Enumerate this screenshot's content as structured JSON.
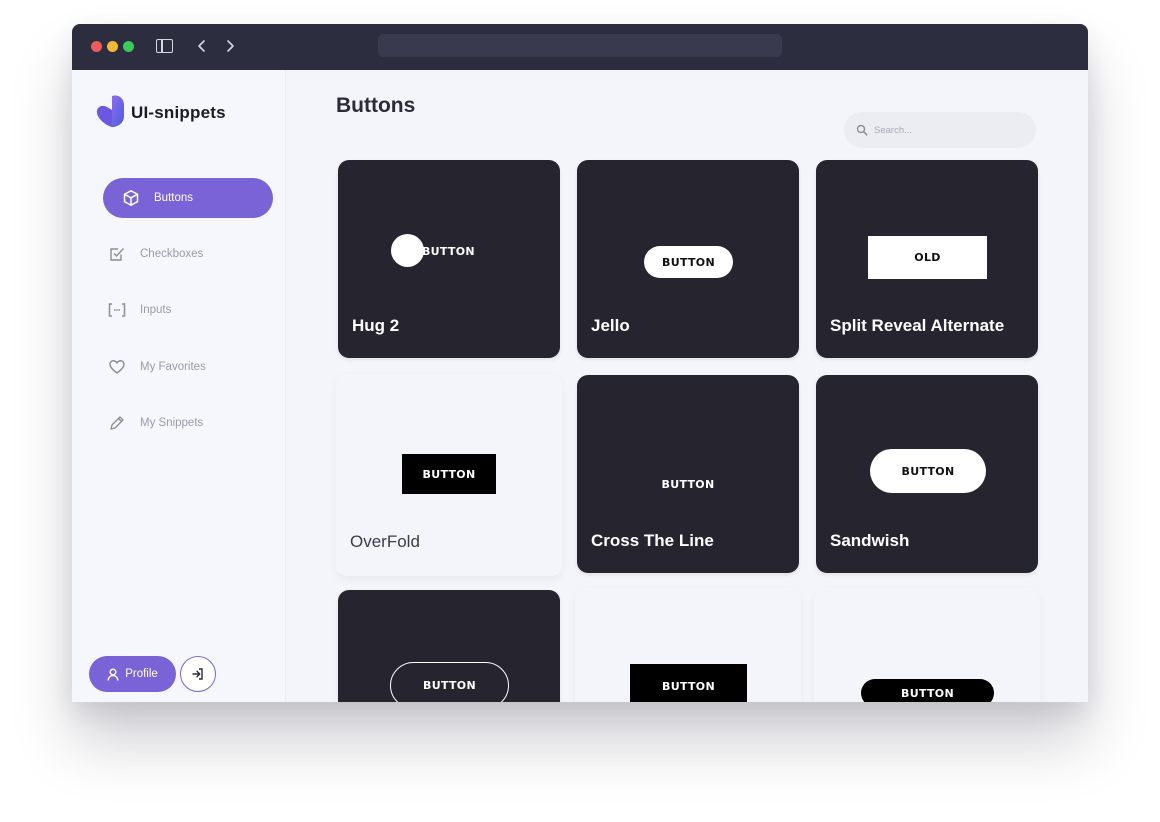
{
  "app": {
    "name": "UI-snippets",
    "page_title": "Buttons",
    "url": ""
  },
  "colors": {
    "accent": "#7a63d6",
    "titlebar": "#2d2d40",
    "card_dark": "#26252f",
    "card_light": "#f4f5fb"
  },
  "titlebar": {
    "icons": [
      "sidebar-toggle-icon",
      "back-arrow-icon",
      "forward-arrow-icon"
    ]
  },
  "sidebar": {
    "items": [
      {
        "label": "Buttons",
        "icon": "cube-icon",
        "active": true
      },
      {
        "label": "Checkboxes",
        "icon": "checkbox-icon",
        "active": false
      },
      {
        "label": "Inputs",
        "icon": "input-brackets-icon",
        "active": false
      },
      {
        "label": "My Favorites",
        "icon": "heart-icon",
        "active": false
      },
      {
        "label": "My Snippets",
        "icon": "pencil-icon",
        "active": false
      }
    ],
    "profile_label": "Profile",
    "logout_icon": "logout-icon"
  },
  "search": {
    "placeholder": "Search..."
  },
  "cards": [
    {
      "title": "Hug 2",
      "demo_label": "BUTTON",
      "theme": "dark"
    },
    {
      "title": "Jello",
      "demo_label": "BUTTON",
      "theme": "dark"
    },
    {
      "title": "Split Reveal Alternate",
      "demo_label": "OLD",
      "theme": "dark"
    },
    {
      "title": "OverFold",
      "demo_label": "BUTTON",
      "theme": "light"
    },
    {
      "title": "Cross The Line",
      "demo_label": "BUTTON",
      "theme": "dark"
    },
    {
      "title": "Sandwish",
      "demo_label": "BUTTON",
      "theme": "dark"
    },
    {
      "title": "",
      "demo_label": "BUTTON",
      "theme": "dark"
    },
    {
      "title": "",
      "demo_label": "BUTTON",
      "theme": "light"
    },
    {
      "title": "",
      "demo_label": "BUTTON",
      "theme": "light"
    }
  ]
}
